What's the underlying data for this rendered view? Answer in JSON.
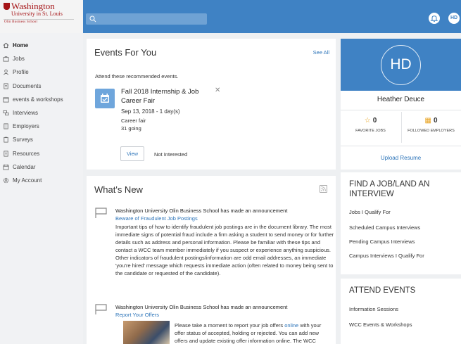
{
  "brand": {
    "line1": "Washington",
    "line2": "University in St. Louis",
    "line3": "Olin Business School"
  },
  "header": {
    "avatar_initials": "HD"
  },
  "sidebar": {
    "items": [
      {
        "label": "Home",
        "icon": "home-icon"
      },
      {
        "label": "Jobs",
        "icon": "briefcase-icon"
      },
      {
        "label": "Profile",
        "icon": "person-icon"
      },
      {
        "label": "Documents",
        "icon": "document-icon"
      },
      {
        "label": "events & workshops",
        "icon": "calendar-icon"
      },
      {
        "label": "Interviews",
        "icon": "interviews-icon"
      },
      {
        "label": "Employers",
        "icon": "building-icon"
      },
      {
        "label": "Surveys",
        "icon": "clipboard-icon"
      },
      {
        "label": "Resources",
        "icon": "resources-icon"
      },
      {
        "label": "Calendar",
        "icon": "calendar-icon"
      },
      {
        "label": "My Account",
        "icon": "gear-icon"
      }
    ]
  },
  "events": {
    "title": "Events For You",
    "see_all": "See All",
    "intro": "Attend these recommended events.",
    "event": {
      "name": "Fall 2018 Internship & Job Career Fair",
      "date": "Sep 13, 2018 - 1 day(s)",
      "type": "Career fair",
      "going": "31 going"
    },
    "view_label": "View",
    "not_interested_label": "Not Interested"
  },
  "news": {
    "title": "What's New",
    "announcements": [
      {
        "header": "Washington University Olin Business School has made an announcement",
        "link": "Beware of Fraudulent Job Postings",
        "body": "Important tips of how to identify fraudulent job postings are in the document library. The most immediate signs of potential fraud include a firm asking a student to send money or for further details such as address and personal information. Please be familiar with these tips and contact a WCC team member immediately if you suspect or experience anything suspicious. Other indicators of fraudulent postings/information are odd email addresses, an immediate 'you're hired' message which requests immediate action (often related to money being sent to the candidate or requested of the candidate)."
      },
      {
        "header": "Washington University Olin Business School has made an announcement",
        "link": "Report Your Offers",
        "body_before": "Please take a moment to report your job offers ",
        "body_link": "online",
        "body_after": " with your offer status of accepted, holding or rejected.  You can add new offers and update existing offer information online. The WCC"
      }
    ]
  },
  "profile": {
    "initials": "HD",
    "name": "Heather Deuce",
    "favorite_jobs_count": "0",
    "favorite_jobs_label": "FAVORITE JOBS",
    "followed_employers_count": "0",
    "followed_employers_label": "FOLLOWED EMPLOYERS",
    "upload_resume": "Upload Resume"
  },
  "find_job": {
    "title": "FIND A JOB/LAND AN INTERVIEW",
    "links": [
      "Jobs I Qualify For",
      "Scheduled Campus Interviews",
      "Pending Campus Interviews",
      "Campus Interviews I Qualify For"
    ]
  },
  "attend_events": {
    "title": "ATTEND EVENTS",
    "links": [
      "Information Sessions",
      "WCC Events & Workshops"
    ]
  },
  "colors": {
    "accent": "#3f82c4",
    "link": "#2c74b9",
    "brand_red": "#a51417"
  }
}
